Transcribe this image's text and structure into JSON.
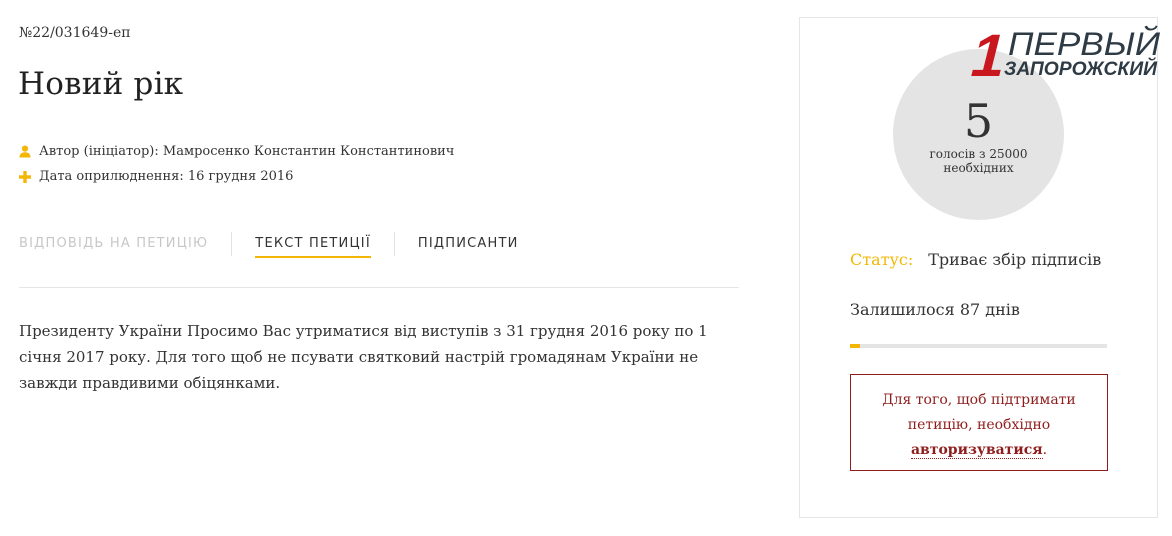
{
  "petition": {
    "number": "№22/031649-еп",
    "title": "Новий рік",
    "author_label": "Автор (ініціатор):",
    "author": "Мамросенко Константин Константинович",
    "date_label": "Дата оприлюднення:",
    "date": "16 грудня 2016",
    "body": "Президенту України Просимо Вас утриматися від виступів з 31 грудня 2016 року по 1 січня 2017 року. Для того щоб не псувати святковий настрій громадянам України не завжди правдивими обіцянками."
  },
  "tabs": [
    {
      "label": "Відповідь на петицію",
      "state": "disabled"
    },
    {
      "label": "Текст петиції",
      "state": "active"
    },
    {
      "label": "Підписанти",
      "state": "normal"
    }
  ],
  "sidebar": {
    "votes": "5",
    "votes_caption": "голосів з 25000 необхідних",
    "status_label": "Статус:",
    "status_value": "Триває збір підписів",
    "days_left": "Залишилося 87 днів",
    "progress_percent": 1,
    "auth_text_before": "Для того, щоб підтримати петицію, необхідно",
    "auth_link": "авторизуватися",
    "auth_text_after": "."
  },
  "logo": {
    "numeral": "1",
    "line1": "ПЕРВЫЙ",
    "line2": "ЗАПОРОЖСКИЙ"
  },
  "colors": {
    "accent": "#f2b705",
    "alert": "#8f1d1d",
    "logo_red": "#c8171e",
    "logo_dark": "#2e3a44"
  },
  "icons": {
    "author": "user-icon",
    "date": "plus-icon"
  }
}
